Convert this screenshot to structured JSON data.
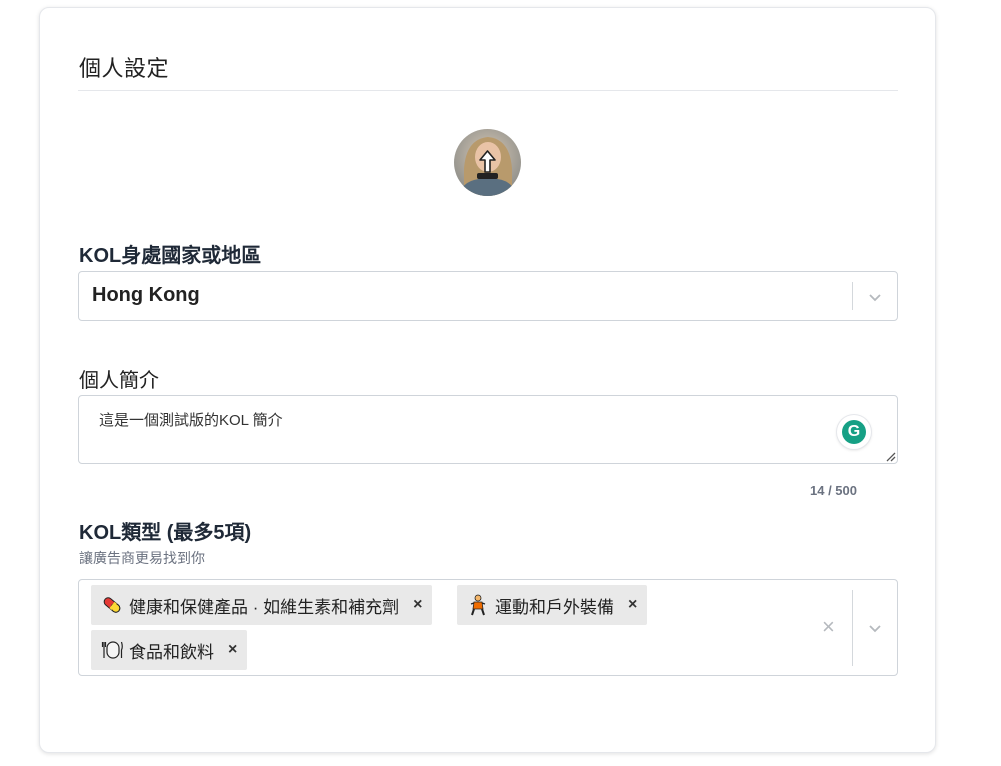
{
  "page": {
    "title": "個人設定"
  },
  "avatar": {
    "icon": "upload-icon"
  },
  "country": {
    "label": "KOL身處國家或地區",
    "value": "Hong Kong"
  },
  "bio": {
    "label": "個人簡介",
    "value": "這是一個測試版的KOL 簡介",
    "counter": "14 / 500",
    "grammarly_letter": "G"
  },
  "categories": {
    "label": "KOL類型 (最多5項)",
    "hint": "讓廣告商更易找到你",
    "chips": [
      {
        "label": "健康和保健產品 · 如維生素和補充劑",
        "icon": "pill-icon",
        "remove": "×"
      },
      {
        "label": "運動和戶外裝備",
        "icon": "climber-icon",
        "remove": "×"
      },
      {
        "label": "食品和飲料",
        "icon": "plate-icon",
        "remove": "×"
      }
    ],
    "clear_label": "×"
  },
  "colors": {
    "border": "#cfd4da",
    "chip_bg": "#e9e9e9",
    "grammarly": "#16a085",
    "muted": "#6b7280"
  }
}
